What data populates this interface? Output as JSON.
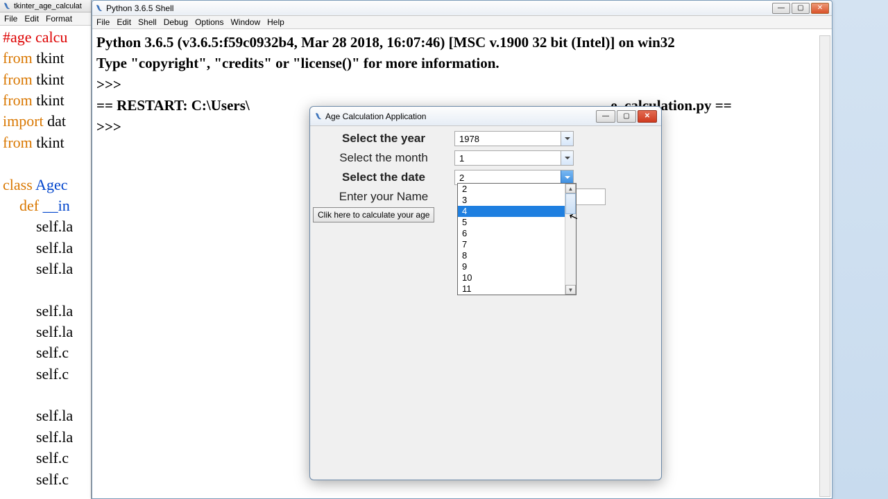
{
  "editor": {
    "title": "tkinter_age_calculat",
    "menu": [
      "File",
      "Edit",
      "Format"
    ],
    "lines": [
      {
        "cls": "kw-comment",
        "t": "#age calcu"
      },
      {
        "cls": "kw-orange",
        "t": "from",
        "rest": " tkint"
      },
      {
        "cls": "kw-orange",
        "t": "from",
        "rest": " tkint"
      },
      {
        "cls": "kw-orange",
        "t": "from",
        "rest": " tkint"
      },
      {
        "cls": "kw-orange",
        "t": "import",
        "rest": " dat"
      },
      {
        "cls": "kw-orange",
        "t": "from",
        "rest": " tkint"
      },
      {
        "cls": "",
        "t": ""
      },
      {
        "cls": "kw-orange",
        "t": "class",
        "restcls": "kw-blue",
        "rest": " Agec"
      },
      {
        "cls": "kw-orange",
        "indent": 1,
        "t": "def",
        "restcls": "kw-blue",
        "rest": " __in"
      },
      {
        "cls": "kw-black",
        "indent": 2,
        "t": "self.la"
      },
      {
        "cls": "kw-black",
        "indent": 2,
        "t": "self.la"
      },
      {
        "cls": "kw-black",
        "indent": 2,
        "t": "self.la"
      },
      {
        "cls": "",
        "t": ""
      },
      {
        "cls": "kw-black",
        "indent": 2,
        "t": "self.la"
      },
      {
        "cls": "kw-black",
        "indent": 2,
        "t": "self.la"
      },
      {
        "cls": "kw-black",
        "indent": 2,
        "t": "self.c"
      },
      {
        "cls": "kw-black",
        "indent": 2,
        "t": "self.c"
      },
      {
        "cls": "",
        "t": ""
      },
      {
        "cls": "kw-black",
        "indent": 2,
        "t": "self.la"
      },
      {
        "cls": "kw-black",
        "indent": 2,
        "t": "self.la"
      },
      {
        "cls": "kw-black",
        "indent": 2,
        "t": "self.c"
      },
      {
        "cls": "kw-black",
        "indent": 2,
        "t": "self.c"
      }
    ]
  },
  "shell": {
    "title": "Python 3.6.5 Shell",
    "menu": [
      "File",
      "Edit",
      "Shell",
      "Debug",
      "Options",
      "Window",
      "Help"
    ],
    "banner1": "Python 3.6.5 (v3.6.5:f59c0932b4, Mar 28 2018, 16:07:46) [MSC v.1900 32 bit (Intel)] on win32",
    "banner2": "Type \"copyright\", \"credits\" or \"license()\" for more information.",
    "prompt": ">>>",
    "restart_pre": "== RESTART: C:\\Users\\",
    "restart_post": "e_calculation.py ==",
    "prompt2": ">>>"
  },
  "tk": {
    "title": "Age Calculation Application",
    "labels": {
      "year": "Select the year",
      "month": "Select the month",
      "date": "Select the date",
      "name": "Enter your Name"
    },
    "values": {
      "year": "1978",
      "month": "1",
      "date": "2"
    },
    "button": "Clik here to calculate your age",
    "dropdown": {
      "highlighted": "4",
      "items": [
        "2",
        "3",
        "4",
        "5",
        "6",
        "7",
        "8",
        "9",
        "10",
        "11"
      ]
    }
  },
  "winbtns": {
    "min": "—",
    "max": "▢",
    "close": "✕"
  }
}
